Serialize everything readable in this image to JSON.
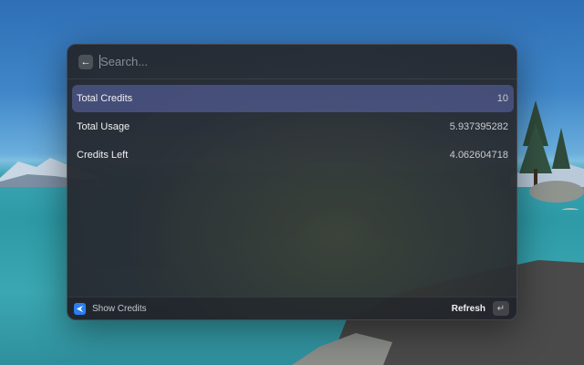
{
  "search": {
    "placeholder": "Search..."
  },
  "results": [
    {
      "label": "Total Credits",
      "value": "10",
      "selected": true
    },
    {
      "label": "Total Usage",
      "value": "5.937395282",
      "selected": false
    },
    {
      "label": "Credits Left",
      "value": "4.062604718",
      "selected": false
    }
  ],
  "footer": {
    "command_title": "Show Credits",
    "primary_action": "Refresh",
    "app_icon": "raycast-app-icon",
    "enter_icon": "return-key-icon"
  },
  "colors": {
    "selected_row": "#5f69af",
    "app_icon": "#2a7ff0"
  }
}
